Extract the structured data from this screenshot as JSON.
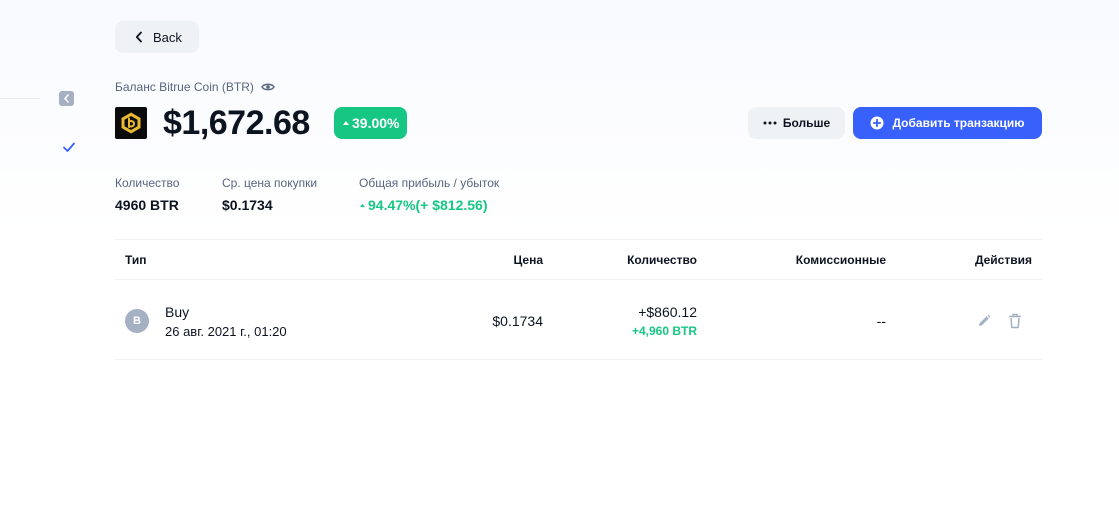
{
  "nav": {
    "back_label": "Back"
  },
  "balance": {
    "label": "Баланс Bitrue Coin (BTR)",
    "value": "$1,672.68",
    "change": "39.00%"
  },
  "actions": {
    "more_label": "Больше",
    "add_transaction_label": "Добавить транзакцию"
  },
  "stats": {
    "quantity": {
      "label": "Количество",
      "value": "4960 BTR"
    },
    "avg_price": {
      "label": "Ср. цена покупки",
      "value": "$0.1734"
    },
    "pnl": {
      "label": "Общая прибыль / убыток",
      "value": "94.47%(+ $812.56)"
    }
  },
  "table": {
    "headers": {
      "type": "Тип",
      "price": "Цена",
      "quantity": "Количество",
      "fees": "Комиссионные",
      "actions": "Действия"
    },
    "rows": [
      {
        "avatar": "B",
        "type": "Buy",
        "date": "26 авг. 2021 г., 01:20",
        "price": "$0.1734",
        "amount_usd": "+$860.12",
        "amount_coin": "+4,960 BTR",
        "fees": "--"
      }
    ]
  },
  "colors": {
    "accent": "#3861fb",
    "positive": "#16c784",
    "muted": "#58667e",
    "surface": "#eff2f5"
  },
  "icons": [
    "chevron-left-icon",
    "eye-icon",
    "bitrue-logo-icon",
    "caret-up-icon",
    "more-dots-icon",
    "plus-circle-icon",
    "check-icon",
    "pencil-icon",
    "trash-icon",
    "collapse-icon"
  ]
}
